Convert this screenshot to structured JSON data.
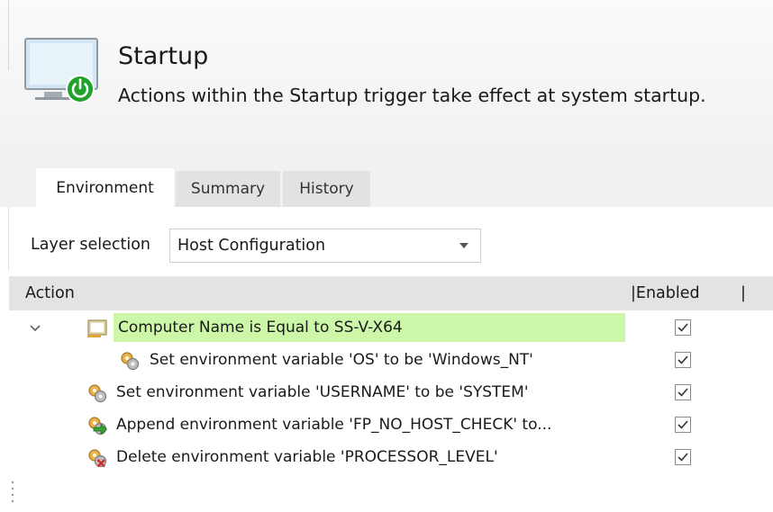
{
  "header": {
    "title": "Startup",
    "description": "Actions within the Startup trigger take effect at system startup.",
    "icon": "monitor-power-icon"
  },
  "tabs": [
    {
      "label": "Environment",
      "active": true
    },
    {
      "label": "Summary",
      "active": false
    },
    {
      "label": "History",
      "active": false
    }
  ],
  "layer": {
    "label": "Layer selection",
    "value": "Host Configuration"
  },
  "grid": {
    "columns": {
      "action": "Action",
      "enabled": "|Enabled",
      "sep": "|"
    },
    "rows": [
      {
        "label": "Computer Name is Equal to SS-V-X64",
        "icon": "condition-icon",
        "enabled": true,
        "highlighted": true,
        "expanded": true
      },
      {
        "label": "Set environment variable 'OS' to be 'Windows_NT'",
        "icon": "gear-set-icon",
        "enabled": true
      },
      {
        "label": "Set environment variable 'USERNAME' to be 'SYSTEM'",
        "icon": "gear-set-icon",
        "enabled": true
      },
      {
        "label": "Append environment variable 'FP_NO_HOST_CHECK' to...",
        "icon": "gear-append-icon",
        "enabled": true
      },
      {
        "label": "Delete environment variable 'PROCESSOR_LEVEL'",
        "icon": "gear-delete-icon",
        "enabled": true
      }
    ]
  },
  "colors": {
    "highlight": "#ccf7a8",
    "power_green": "#1fa32a",
    "header_bg": "#f1f1f1",
    "grid_header_bg": "#e3e3e3"
  }
}
